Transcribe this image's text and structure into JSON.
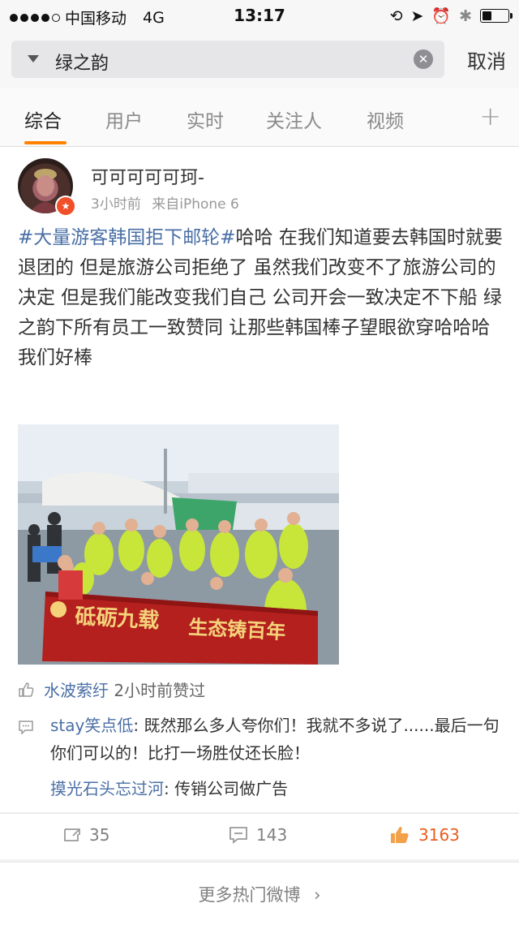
{
  "status": {
    "carrier": "中国移动",
    "network": "4G",
    "time": "13:17"
  },
  "search": {
    "query": "绿之韵",
    "cancel": "取消"
  },
  "tabs": [
    "综合",
    "用户",
    "实时",
    "关注人",
    "视频"
  ],
  "post": {
    "username": "可可可可可珂-",
    "time": "3小时前",
    "source": "来自iPhone 6",
    "hashtag": "#大量游客韩国拒下邮轮#",
    "text": "哈哈 在我们知道要去韩国时就要退团的 但是旅游公司拒绝了 虽然我们改变不了旅游公司的决定 但是我们能改变我们自己 公司开会一致决定不下船 绿之韵下所有员工一致赞同 让那些韩国棒子望眼欲穿哈哈哈 我们好棒",
    "banner_left": "砥砺九载",
    "banner_right": "生态铸百年"
  },
  "liked_by": {
    "name": "水波萦纡",
    "text": "2小时前赞过"
  },
  "comments": [
    {
      "name": "stay笑点低",
      "text": ": 既然那么多人夸你们！我就不多说了......最后一句你们可以的！比打一场胜仗还长脸！"
    },
    {
      "name": "摸光石头忘过河",
      "text": ": 传销公司做广告"
    }
  ],
  "actions": {
    "reposts": "35",
    "comments": "143",
    "likes": "3163"
  },
  "more": "更多热门微博",
  "colors": {
    "accent": "#ff8200",
    "link": "#4a6fa5",
    "liked": "#ea5d20"
  }
}
